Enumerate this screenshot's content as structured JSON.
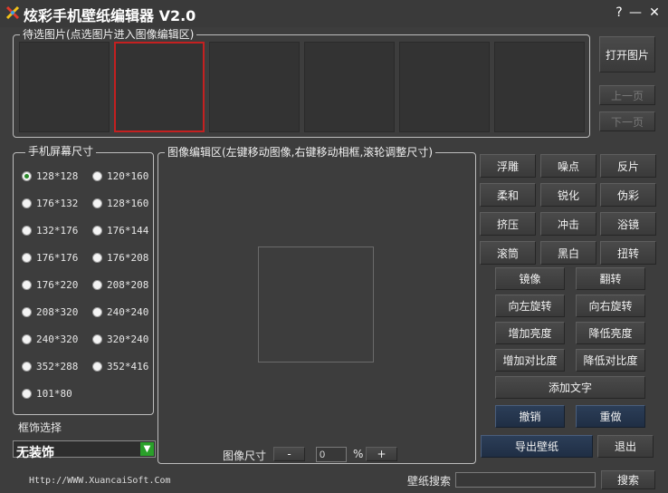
{
  "app": {
    "title": "炫彩手机壁纸编辑器 V2.0",
    "help": "?",
    "minimize": "—",
    "close": "✕"
  },
  "pending": {
    "legend": "待选图片(点选图片进入图像编辑区)",
    "thumb_count": 6,
    "selected_index": 1,
    "open_button": "打开图片",
    "prev_button": "上一页",
    "next_button": "下一页"
  },
  "screen_size": {
    "legend": "手机屏幕尺寸",
    "options": [
      "128*128",
      "120*160",
      "176*132",
      "128*160",
      "132*176",
      "176*144",
      "176*176",
      "176*208",
      "176*220",
      "208*208",
      "208*320",
      "240*240",
      "240*320",
      "320*240",
      "352*288",
      "352*416",
      "101*80"
    ],
    "selected_index": 0
  },
  "frame": {
    "label": "框饰选择",
    "selected": "无装饰"
  },
  "editor": {
    "legend": "图像编辑区(左键移动图像,右键移动相框,滚轮调整尺寸)",
    "size_label": "图像尺寸",
    "minus": "-",
    "size_value": "0",
    "percent": "%",
    "plus": "+"
  },
  "effects": {
    "grid": [
      "浮雕",
      "噪点",
      "反片",
      "柔和",
      "锐化",
      "伪彩",
      "挤压",
      "冲击",
      "浴镜",
      "滚筒",
      "黑白",
      "扭转"
    ],
    "pairs": [
      "镜像",
      "翻转",
      "向左旋转",
      "向右旋转",
      "增加亮度",
      "降低亮度",
      "增加对比度",
      "降低对比度"
    ],
    "add_text": "添加文字",
    "undo": "撤销",
    "redo": "重做",
    "export": "导出壁纸",
    "exit": "退出"
  },
  "footer": {
    "url": "Http://WWW.XuancaiSoft.Com",
    "search_label": "壁纸搜索",
    "search_value": "",
    "search_button": "搜索"
  }
}
